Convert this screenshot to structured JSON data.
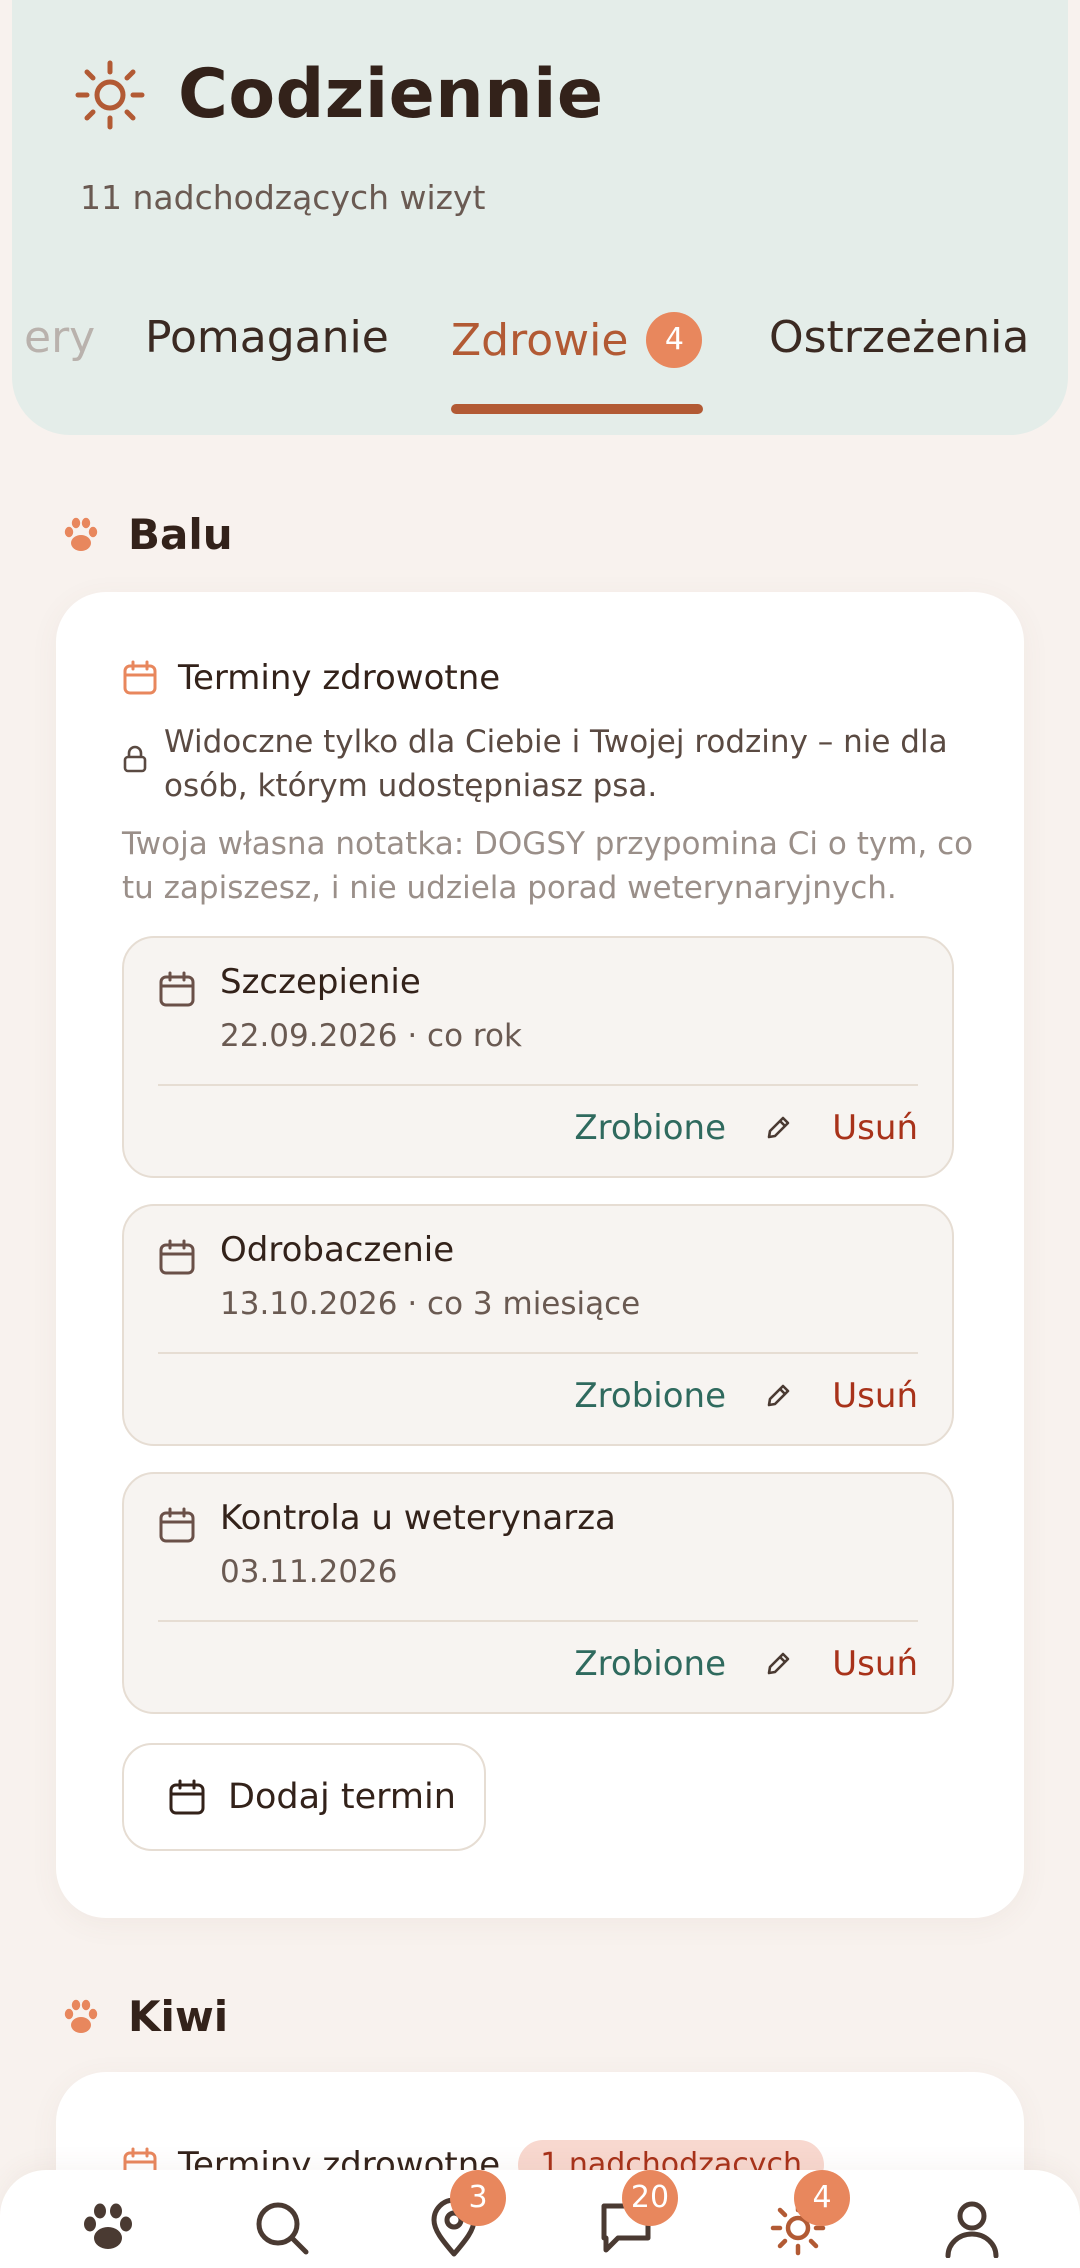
{
  "header": {
    "title": "Codziennie",
    "subtitle": "11 nadchodzących wizyt",
    "tabs": [
      {
        "label": "ery"
      },
      {
        "label": "Pomaganie"
      },
      {
        "label": "Zdrowie",
        "badge": "4"
      },
      {
        "label": "Ostrzeżenia"
      }
    ],
    "active_tab": "Zdrowie"
  },
  "sections": [
    {
      "dog_name": "Balu",
      "card": {
        "title": "Terminy zdrowotne",
        "privacy_note": "Widoczne tylko dla Ciebie i Twojej rodziny – nie dla osób, którym udostępniasz psa.",
        "info_note": "Twoja własna notatka: DOGSY przypomina Ci o tym, co tu zapiszesz, i nie udziela porad weterynaryjnych.",
        "appointments": [
          {
            "name": "Szczepienie",
            "details": "22.09.2026 · co rok",
            "done_label": "Zrobione",
            "delete_label": "Usuń"
          },
          {
            "name": "Odrobaczenie",
            "details": "13.10.2026 · co 3 miesiące",
            "done_label": "Zrobione",
            "delete_label": "Usuń"
          },
          {
            "name": "Kontrola u weterynarza",
            "details": "03.11.2026",
            "done_label": "Zrobione",
            "delete_label": "Usuń"
          }
        ],
        "add_button_label": "Dodaj termin"
      }
    },
    {
      "dog_name": "Kiwi",
      "card": {
        "title": "Terminy zdrowotne",
        "upcoming_badge": "1 nadchodzących"
      }
    }
  ],
  "bottom_nav": [
    {
      "icon": "paw-icon"
    },
    {
      "icon": "search-icon"
    },
    {
      "icon": "map-pin-icon",
      "badge": "3"
    },
    {
      "icon": "chat-icon",
      "badge": "20"
    },
    {
      "icon": "sun-icon",
      "badge": "4"
    },
    {
      "icon": "profile-icon"
    }
  ],
  "colors": {
    "accent": "#b25a34",
    "badge": "#e8875d",
    "done": "#2f6a5e",
    "delete": "#a8321a",
    "header_bg": "#e4ede9"
  }
}
